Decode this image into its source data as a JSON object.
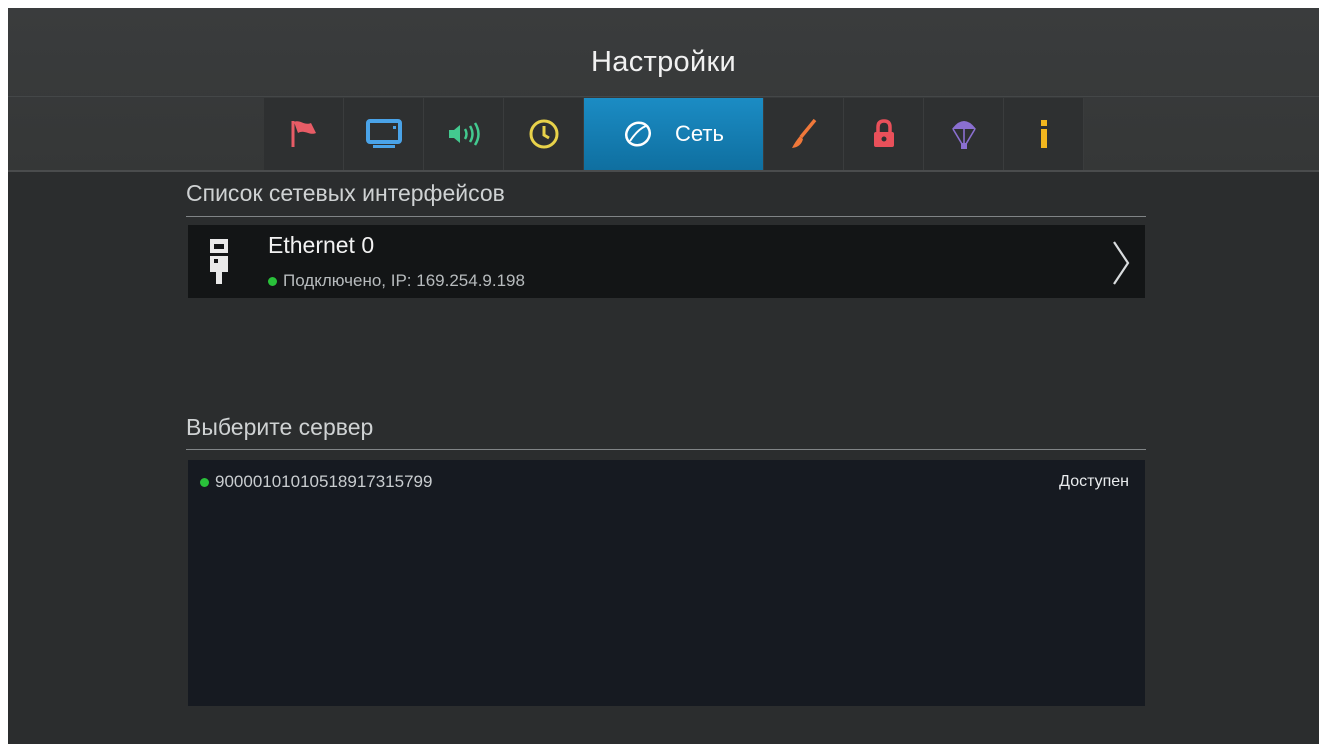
{
  "header": {
    "title": "Настройки",
    "tabs": [
      {
        "icon": "flag-icon",
        "color": "#e85c66"
      },
      {
        "icon": "tv-icon",
        "color": "#4aa3e8"
      },
      {
        "icon": "speaker-icon",
        "color": "#43c98f"
      },
      {
        "icon": "clock-icon",
        "color": "#e8d24a"
      },
      {
        "icon": "globe-icon",
        "color": "#ffffff",
        "label": "Сеть",
        "active": true
      },
      {
        "icon": "brush-icon",
        "color": "#f0783a"
      },
      {
        "icon": "lock-icon",
        "color": "#e9505a"
      },
      {
        "icon": "parachute-icon",
        "color": "#8a6fd0"
      },
      {
        "icon": "info-icon",
        "color": "#f2b61e"
      }
    ]
  },
  "interfaces": {
    "title": "Список сетевых интерфейсов",
    "items": [
      {
        "name": "Ethernet 0",
        "status": "Подключено, IP: 169.254.9.198",
        "status_color": "#29c13a"
      }
    ]
  },
  "servers": {
    "title": "Выберите сервер",
    "items": [
      {
        "id": "9000010101051891731​5799",
        "state": "Доступен",
        "status_color": "#29c13a"
      }
    ]
  }
}
